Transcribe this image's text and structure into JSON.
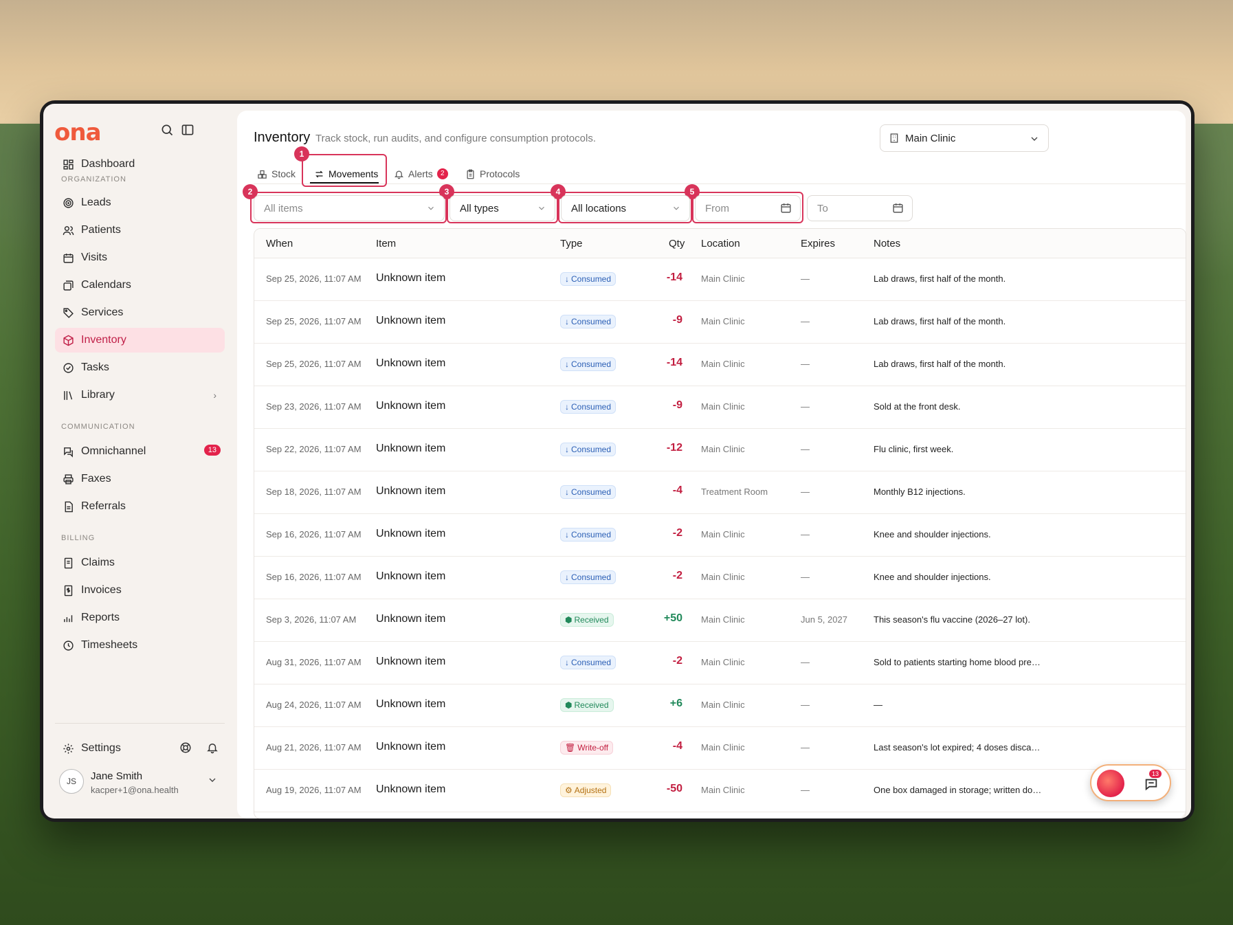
{
  "app": {
    "logo": "ona"
  },
  "sidebar": {
    "sections": {
      "organization": "ORGANIZATION",
      "communication": "COMMUNICATION",
      "billing": "BILLING"
    },
    "items": [
      {
        "label": "Dashboard",
        "icon": "dashboard-icon"
      },
      {
        "label": "Leads",
        "icon": "target-icon"
      },
      {
        "label": "Patients",
        "icon": "users-icon"
      },
      {
        "label": "Visits",
        "icon": "calendar-icon"
      },
      {
        "label": "Calendars",
        "icon": "calendars-icon"
      },
      {
        "label": "Services",
        "icon": "tag-icon"
      },
      {
        "label": "Inventory",
        "icon": "box-icon",
        "active": true
      },
      {
        "label": "Tasks",
        "icon": "check-circle-icon"
      },
      {
        "label": "Library",
        "icon": "library-icon"
      },
      {
        "label": "Omnichannel",
        "icon": "chat-icon",
        "badge": "13"
      },
      {
        "label": "Faxes",
        "icon": "printer-icon"
      },
      {
        "label": "Referrals",
        "icon": "document-icon"
      },
      {
        "label": "Claims",
        "icon": "claims-icon"
      },
      {
        "label": "Invoices",
        "icon": "invoice-icon"
      },
      {
        "label": "Reports",
        "icon": "chart-icon"
      },
      {
        "label": "Timesheets",
        "icon": "clock-icon"
      }
    ],
    "settings": "Settings",
    "user": {
      "initials": "JS",
      "name": "Jane Smith",
      "email": "kacper+1@ona.health"
    }
  },
  "header": {
    "title": "Inventory",
    "subtitle": "Track stock, run audits, and configure consumption protocols.",
    "location": "Main Clinic"
  },
  "tabs": [
    {
      "label": "Stock"
    },
    {
      "label": "Movements",
      "active": true
    },
    {
      "label": "Alerts",
      "badge": "2"
    },
    {
      "label": "Protocols"
    }
  ],
  "annotations": [
    "1",
    "2",
    "3",
    "4",
    "5"
  ],
  "filters": {
    "items": "All items",
    "types": "All types",
    "locations": "All locations",
    "from": "From",
    "to": "To"
  },
  "table": {
    "columns": [
      "When",
      "Item",
      "Type",
      "Qty",
      "Location",
      "Expires",
      "Notes"
    ],
    "rows": [
      {
        "when": "Sep 25, 2026, 11:07 AM",
        "item": "Unknown item",
        "type": "Consumed",
        "qty": "-14",
        "location": "Main Clinic",
        "expires": "—",
        "notes": "Lab draws, first half of the month."
      },
      {
        "when": "Sep 25, 2026, 11:07 AM",
        "item": "Unknown item",
        "type": "Consumed",
        "qty": "-9",
        "location": "Main Clinic",
        "expires": "—",
        "notes": "Lab draws, first half of the month."
      },
      {
        "when": "Sep 25, 2026, 11:07 AM",
        "item": "Unknown item",
        "type": "Consumed",
        "qty": "-14",
        "location": "Main Clinic",
        "expires": "—",
        "notes": "Lab draws, first half of the month."
      },
      {
        "when": "Sep 23, 2026, 11:07 AM",
        "item": "Unknown item",
        "type": "Consumed",
        "qty": "-9",
        "location": "Main Clinic",
        "expires": "—",
        "notes": "Sold at the front desk."
      },
      {
        "when": "Sep 22, 2026, 11:07 AM",
        "item": "Unknown item",
        "type": "Consumed",
        "qty": "-12",
        "location": "Main Clinic",
        "expires": "—",
        "notes": "Flu clinic, first week."
      },
      {
        "when": "Sep 18, 2026, 11:07 AM",
        "item": "Unknown item",
        "type": "Consumed",
        "qty": "-4",
        "location": "Treatment Room",
        "expires": "—",
        "notes": "Monthly B12 injections."
      },
      {
        "when": "Sep 16, 2026, 11:07 AM",
        "item": "Unknown item",
        "type": "Consumed",
        "qty": "-2",
        "location": "Main Clinic",
        "expires": "—",
        "notes": "Knee and shoulder injections."
      },
      {
        "when": "Sep 16, 2026, 11:07 AM",
        "item": "Unknown item",
        "type": "Consumed",
        "qty": "-2",
        "location": "Main Clinic",
        "expires": "—",
        "notes": "Knee and shoulder injections."
      },
      {
        "when": "Sep 3, 2026, 11:07 AM",
        "item": "Unknown item",
        "type": "Received",
        "qty": "+50",
        "location": "Main Clinic",
        "expires": "Jun 5, 2027",
        "notes": "This season's flu vaccine (2026–27 lot)."
      },
      {
        "when": "Aug 31, 2026, 11:07 AM",
        "item": "Unknown item",
        "type": "Consumed",
        "qty": "-2",
        "location": "Main Clinic",
        "expires": "—",
        "notes": "Sold to patients starting home blood pres..."
      },
      {
        "when": "Aug 24, 2026, 11:07 AM",
        "item": "Unknown item",
        "type": "Received",
        "qty": "+6",
        "location": "Main Clinic",
        "expires": "—",
        "notes": "—"
      },
      {
        "when": "Aug 21, 2026, 11:07 AM",
        "item": "Unknown item",
        "type": "Write-off",
        "qty": "-4",
        "location": "Main Clinic",
        "expires": "—",
        "notes": "Last season's lot expired; 4 doses discard..."
      },
      {
        "when": "Aug 19, 2026, 11:07 AM",
        "item": "Unknown item",
        "type": "Adjusted",
        "qty": "-50",
        "location": "Main Clinic",
        "expires": "—",
        "notes": "One box damaged in storage; written dow..."
      }
    ]
  },
  "chat_widget": {
    "badge": "13"
  }
}
